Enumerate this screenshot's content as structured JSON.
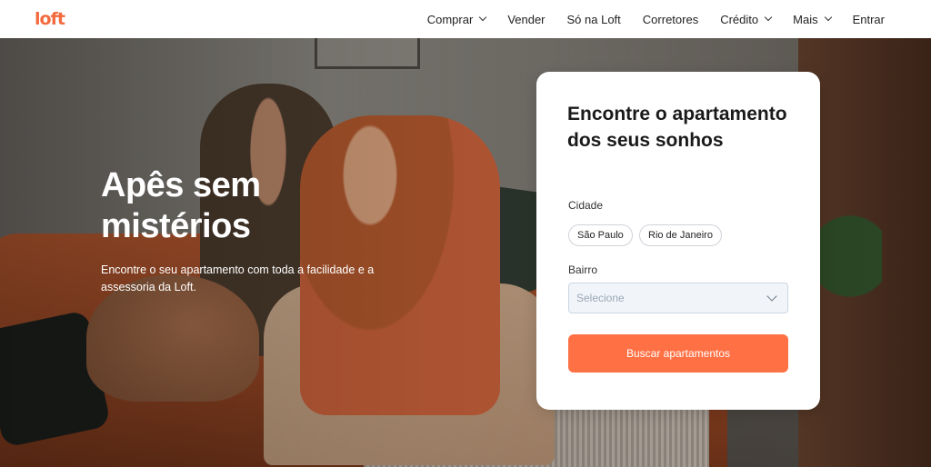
{
  "header": {
    "logo": "loft",
    "nav": [
      {
        "label": "Comprar",
        "dropdown": true
      },
      {
        "label": "Vender",
        "dropdown": false
      },
      {
        "label": "Só na Loft",
        "dropdown": false
      },
      {
        "label": "Corretores",
        "dropdown": false
      },
      {
        "label": "Crédito",
        "dropdown": true
      },
      {
        "label": "Mais",
        "dropdown": true
      },
      {
        "label": "Entrar",
        "dropdown": false
      }
    ]
  },
  "hero": {
    "title": "Apês sem mistérios",
    "subtitle": "Encontre o seu apartamento com toda a facilidade e a assessoria da Loft."
  },
  "search": {
    "title": "Encontre o apartamento dos seus sonhos",
    "city_label": "Cidade",
    "cities": [
      "São Paulo",
      "Rio de Janeiro"
    ],
    "neighborhood_label": "Bairro",
    "neighborhood_placeholder": "Selecione",
    "submit_label": "Buscar apartamentos"
  },
  "colors": {
    "brand": "#f26a3d",
    "button": "#ff7145"
  }
}
